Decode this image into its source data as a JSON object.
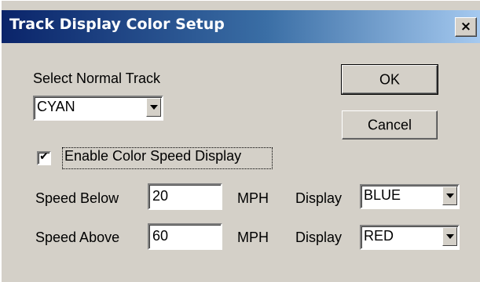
{
  "window": {
    "title": "Track Display Color Setup",
    "close_glyph": "×",
    "close_icon": "close-icon"
  },
  "normal_track": {
    "label": "Select Normal Track",
    "selected": "CYAN"
  },
  "buttons": {
    "ok_label": "OK",
    "cancel_label": "Cancel"
  },
  "enable_color_speed": {
    "label": "Enable Color Speed Display",
    "checked": true,
    "check_glyph": "✔"
  },
  "speed_below": {
    "label": "Speed Below",
    "value": "20",
    "unit": "MPH",
    "display_label": "Display",
    "display_value": "BLUE"
  },
  "speed_above": {
    "label": "Speed Above",
    "value": "60",
    "unit": "MPH",
    "display_label": "Display",
    "display_value": "RED"
  },
  "colors": {
    "title_bar_start": "#0a246a",
    "title_bar_end": "#a6caf0",
    "dialog_face": "#d4d0c8"
  }
}
